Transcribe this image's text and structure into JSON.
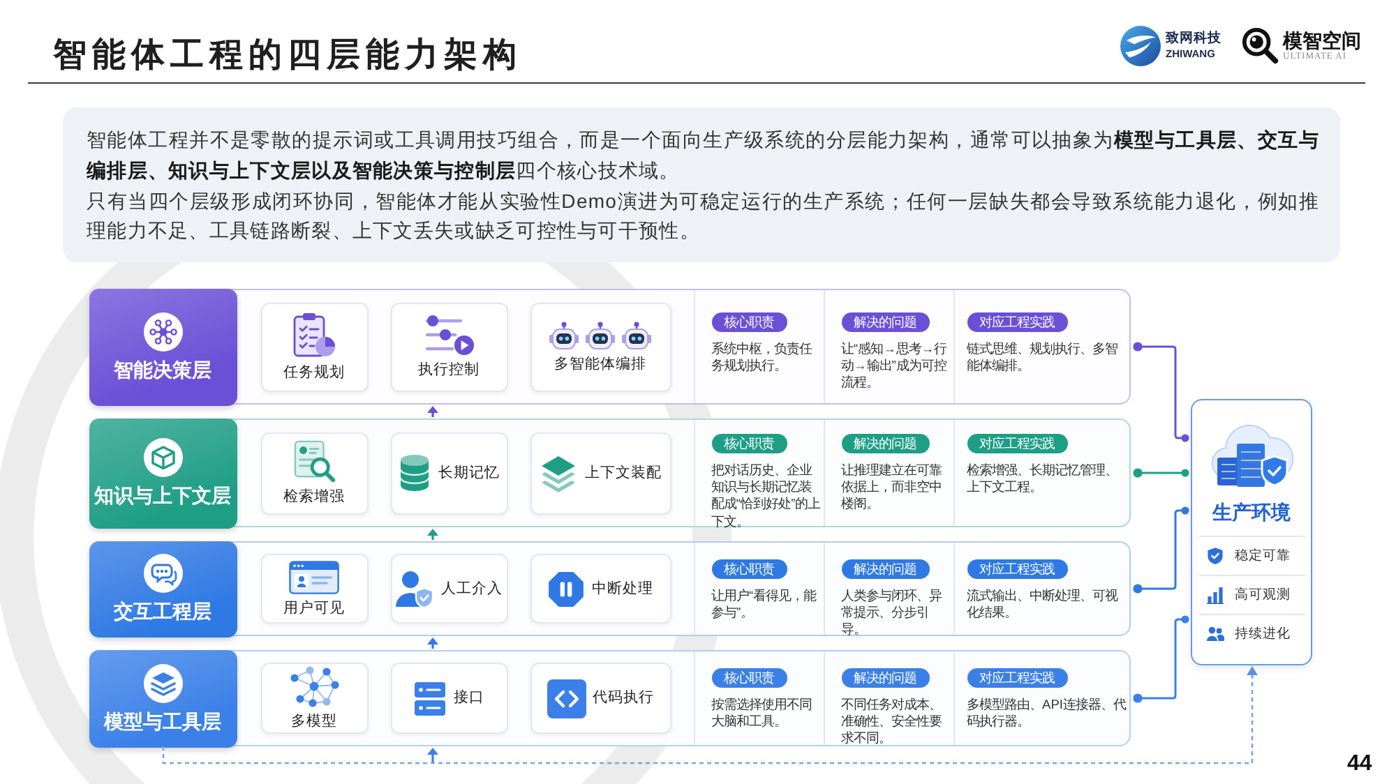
{
  "header": {
    "title": "智能体工程的四层能力架构",
    "logos": [
      {
        "name": "致网科技",
        "subtitle": "ZHIWANG"
      },
      {
        "name": "模智空间",
        "subtitle": "ULTIMATE AI"
      }
    ]
  },
  "intro": {
    "paragraphs": [
      "智能体工程并不是零散的提示词或工具调用技巧组合，而是一个面向生产级系统的分层能力架构，通常可以抽象为**模型与工具层、交互与编排层、知识与上下文层以及智能决策与控制层**四个核心技术域。",
      "只有当四个层级形成闭环协同，智能体才能从实验性Demo演进为可稳定运行的生产系统；任何一层缺失都会导致系统能力退化，例如推理能力不足、工具链路断裂、上下文丢失或缺乏可控性与可干预性。"
    ]
  },
  "layers": [
    {
      "title": "智能决策层",
      "color": "#6a4fd7",
      "features": [
        {
          "label": "任务规划",
          "kind": "stacked"
        },
        {
          "label": "执行控制",
          "kind": "stacked"
        },
        {
          "label": "多智能体编排",
          "kind": "stacked"
        }
      ],
      "notes": [
        {
          "heading": "核心职责",
          "text": "系统中枢，负责任务规划执行。"
        },
        {
          "heading": "解决的问题",
          "text": "让“感知→思考→行动→输出”成为可控流程。"
        },
        {
          "heading": "对应工程实践",
          "text": "链式思维、规划执行、多智能体编排。"
        }
      ]
    },
    {
      "title": "知识与上下文层",
      "color": "#1f9e86",
      "features": [
        {
          "label": "检索增强",
          "kind": "stacked"
        },
        {
          "label": "长期记忆",
          "kind": "inline"
        },
        {
          "label": "上下文装配",
          "kind": "inline"
        }
      ],
      "notes": [
        {
          "heading": "核心职责",
          "text": "把对话历史、企业知识与长期记忆装配成“恰到好处”的上下文。"
        },
        {
          "heading": "解决的问题",
          "text": "让推理建立在可靠依据上，而非空中楼阁。"
        },
        {
          "heading": "对应工程实践",
          "text": "检索增强、长期记忆管理、上下文工程。"
        }
      ]
    },
    {
      "title": "交互工程层",
      "color": "#2f79e4",
      "features": [
        {
          "label": "用户可见",
          "kind": "stacked"
        },
        {
          "label": "人工介入",
          "kind": "inline"
        },
        {
          "label": "中断处理",
          "kind": "inline"
        }
      ],
      "notes": [
        {
          "heading": "核心职责",
          "text": "让用户“看得见，能参与”。"
        },
        {
          "heading": "解决的问题",
          "text": "人类参与闭环、异常提示、分步引导。"
        },
        {
          "heading": "对应工程实践",
          "text": "流式输出、中断处理、可视化结果。"
        }
      ]
    },
    {
      "title": "模型与工具层",
      "color": "#3a80e8",
      "features": [
        {
          "label": "多模型",
          "kind": "stacked"
        },
        {
          "label": "接口",
          "kind": "inline"
        },
        {
          "label": "代码执行",
          "kind": "inline"
        }
      ],
      "notes": [
        {
          "heading": "核心职责",
          "text": "按需选择使用不同大脑和工具。"
        },
        {
          "heading": "解决的问题",
          "text": "不同任务对成本、准确性、安全性要求不同。"
        },
        {
          "heading": "对应工程实践",
          "text": "多模型路由、API连接器、代码执行器。"
        }
      ]
    }
  ],
  "production": {
    "title": "生产环境",
    "items": [
      "稳定可靠",
      "高可观测",
      "持续进化"
    ]
  },
  "page_number": "44"
}
